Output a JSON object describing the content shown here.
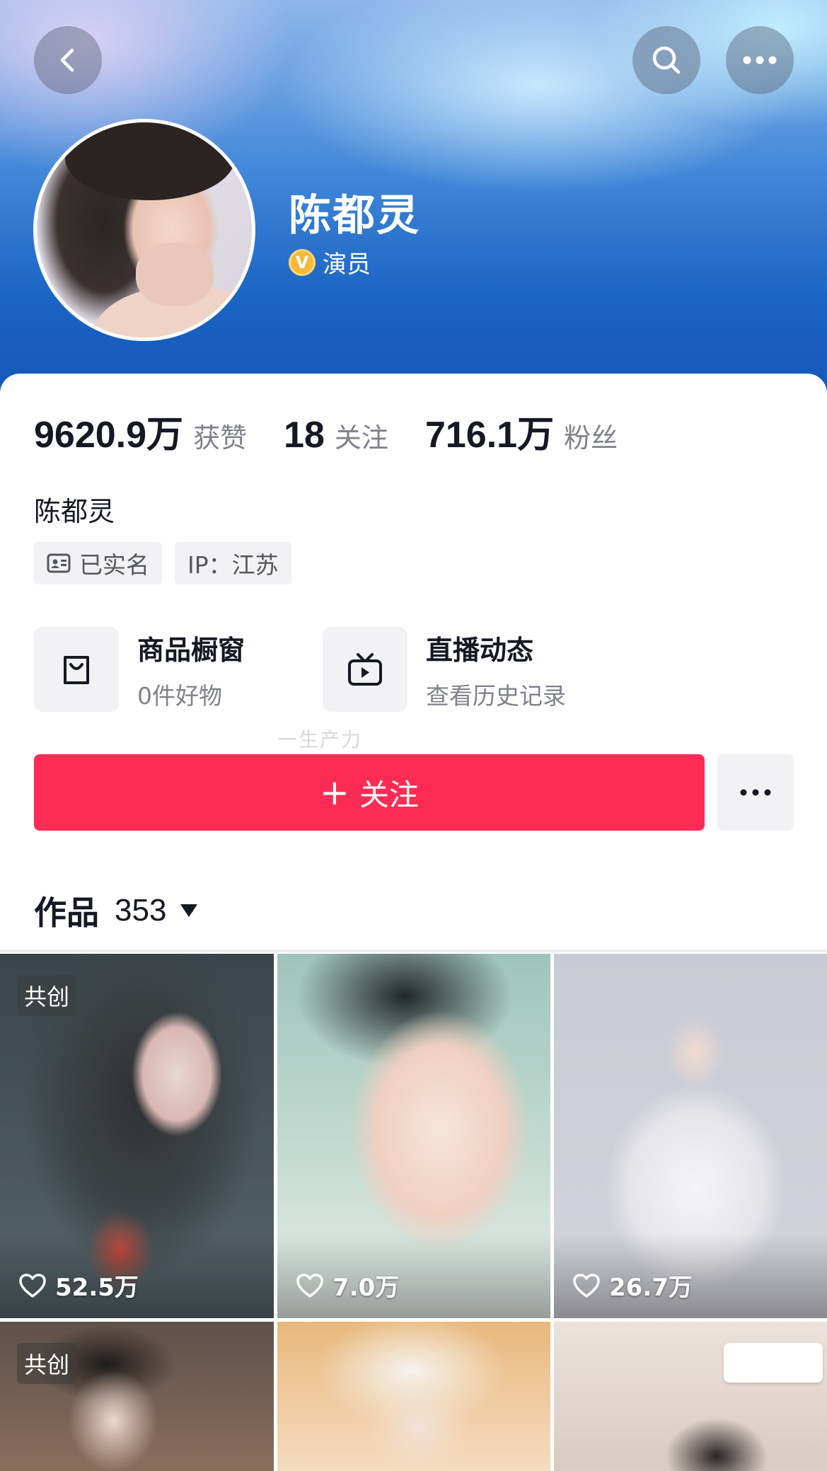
{
  "header": {
    "back_icon": "chevron-left-icon",
    "search_icon": "search-icon",
    "more_icon": "more-horizontal-icon"
  },
  "profile": {
    "name": "陈都灵",
    "verify_badge": "V",
    "verify_title": "演员",
    "stats": [
      {
        "value": "9620.9万",
        "label": "获赞"
      },
      {
        "value": "18",
        "label": "关注"
      },
      {
        "value": "716.1万",
        "label": "粉丝"
      }
    ],
    "bio_name": "陈都灵",
    "tags": [
      {
        "icon": "id-card-icon",
        "text": "已实名"
      },
      {
        "text": "IP：江苏"
      }
    ],
    "services": [
      {
        "icon": "shopping-bag-icon",
        "title": "商品橱窗",
        "subtitle": "0件好物"
      },
      {
        "icon": "tv-play-icon",
        "title": "直播动态",
        "subtitle": "查看历史记录"
      }
    ],
    "watermark": "一生产力",
    "follow_plus": "+",
    "follow_label": "关注"
  },
  "works": {
    "label": "作品",
    "count": "353",
    "items": [
      {
        "badge": "共创",
        "likes": "52.5万"
      },
      {
        "badge": "",
        "likes": "7.0万"
      },
      {
        "badge": "",
        "likes": "26.7万"
      },
      {
        "badge": "共创",
        "likes": ""
      },
      {
        "badge": "",
        "likes": ""
      },
      {
        "badge": "",
        "likes": ""
      }
    ]
  },
  "colors": {
    "accent": "#fe2c55",
    "banner": "#1a64c4",
    "verify": "#f4b938"
  }
}
